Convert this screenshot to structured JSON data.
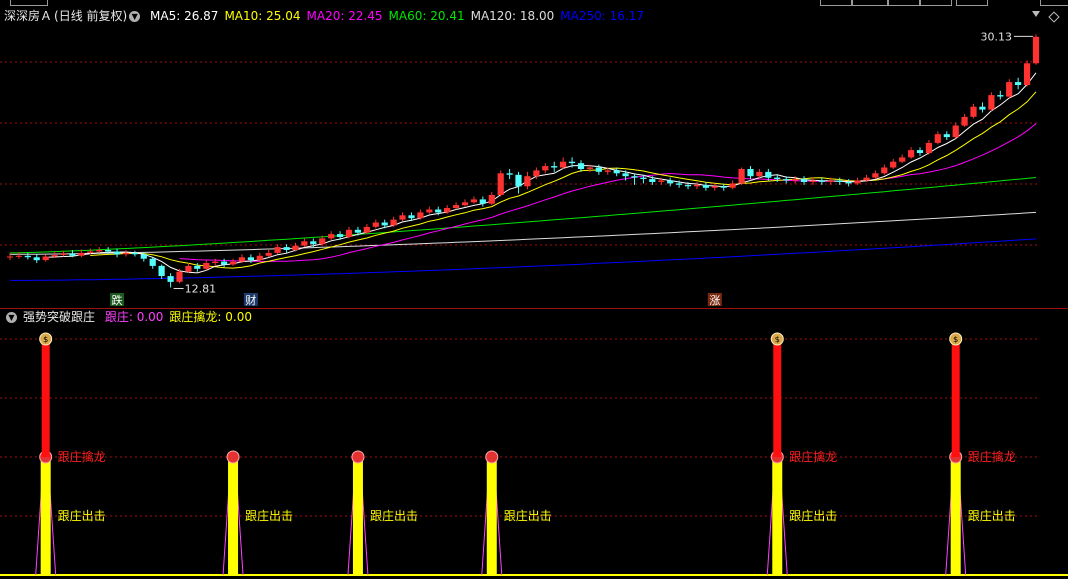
{
  "colors": {
    "up": "#ff3232",
    "down": "#54fcfc",
    "ma5": "#ffffff",
    "ma10": "#ffff00",
    "ma20": "#ff00ff",
    "ma60": "#00e600",
    "ma120": "#dddddd",
    "ma250": "#0000ff",
    "grid": "#a01010",
    "zhuang": "#ff40ff",
    "qinlong": "#ffff00"
  },
  "price_panel": {
    "stock_name": "深深房Ａ",
    "period": "(日线 前复权)",
    "ma": [
      {
        "label": "MA5:",
        "value": "26.87",
        "color": "#ffffff"
      },
      {
        "label": "MA10:",
        "value": "25.04",
        "color": "#ffff00"
      },
      {
        "label": "MA20:",
        "value": "22.45",
        "color": "#ff00ff"
      },
      {
        "label": "MA60:",
        "value": "20.41",
        "color": "#00e600"
      },
      {
        "label": "MA120:",
        "value": "18.00",
        "color": "#dddddd"
      },
      {
        "label": "MA250:",
        "value": "16.17",
        "color": "#0000ff"
      }
    ],
    "high_label": "30.13",
    "low_label": "12.81",
    "markers": [
      {
        "text": "跌",
        "bg": "#1d5a1d",
        "fg": "#ffffff"
      },
      {
        "text": "财",
        "bg": "#1b3a6a",
        "fg": "#ffffff"
      },
      {
        "text": "涨",
        "bg": "#7a2a10",
        "fg": "#ffffff"
      }
    ]
  },
  "indicator_panel": {
    "name": "强势突破跟庄",
    "items": [
      {
        "label": "跟庄:",
        "value": "0.00",
        "color": "#ff40ff"
      },
      {
        "label": "跟庄擒龙:",
        "value": "0.00",
        "color": "#ffff00"
      }
    ],
    "label_qinlong": "跟庄擒龙",
    "label_chuji": "跟庄出击"
  },
  "chart_data": {
    "type": "candlestick",
    "title": "深深房Ａ (日线 前复权)",
    "y_labels_shown": [
      "30.13",
      "12.81"
    ],
    "candles": [
      [
        14.9,
        14.95,
        15.2,
        14.7
      ],
      [
        14.95,
        15.0,
        15.25,
        14.8
      ],
      [
        15.0,
        14.9,
        15.2,
        14.75
      ],
      [
        14.9,
        14.7,
        15.1,
        14.5
      ],
      [
        14.7,
        14.95,
        15.1,
        14.6
      ],
      [
        14.95,
        15.05,
        15.3,
        14.85
      ],
      [
        15.05,
        15.15,
        15.35,
        14.95
      ],
      [
        15.15,
        15.0,
        15.4,
        14.9
      ],
      [
        15.0,
        15.2,
        15.45,
        14.9
      ],
      [
        15.2,
        15.3,
        15.5,
        15.1
      ],
      [
        15.3,
        15.4,
        15.6,
        15.2
      ],
      [
        15.4,
        15.3,
        15.6,
        15.1
      ],
      [
        15.3,
        15.1,
        15.5,
        14.9
      ],
      [
        15.1,
        15.2,
        15.4,
        14.95
      ],
      [
        15.2,
        15.1,
        15.35,
        14.95
      ],
      [
        15.1,
        14.8,
        15.25,
        14.6
      ],
      [
        14.8,
        14.3,
        14.9,
        14.1
      ],
      [
        14.3,
        13.6,
        14.4,
        13.4
      ],
      [
        13.6,
        13.2,
        13.8,
        12.81
      ],
      [
        13.2,
        13.9,
        14.1,
        13.1
      ],
      [
        13.9,
        14.3,
        14.5,
        13.8
      ],
      [
        14.3,
        14.1,
        14.5,
        13.9
      ],
      [
        14.1,
        14.5,
        14.7,
        14.0
      ],
      [
        14.5,
        14.6,
        14.8,
        14.3
      ],
      [
        14.6,
        14.4,
        14.8,
        14.2
      ],
      [
        14.4,
        14.6,
        14.8,
        14.3
      ],
      [
        14.6,
        14.9,
        15.1,
        14.5
      ],
      [
        14.9,
        14.7,
        15.1,
        14.5
      ],
      [
        14.7,
        15.0,
        15.2,
        14.6
      ],
      [
        15.0,
        15.2,
        15.4,
        14.9
      ],
      [
        15.2,
        15.6,
        15.8,
        15.1
      ],
      [
        15.6,
        15.4,
        15.8,
        15.2
      ],
      [
        15.4,
        15.7,
        15.9,
        15.3
      ],
      [
        15.7,
        16.0,
        16.2,
        15.6
      ],
      [
        16.0,
        15.8,
        16.2,
        15.6
      ],
      [
        15.8,
        16.2,
        16.4,
        15.7
      ],
      [
        16.2,
        16.5,
        16.7,
        16.1
      ],
      [
        16.5,
        16.3,
        16.7,
        16.1
      ],
      [
        16.3,
        16.8,
        17.0,
        16.2
      ],
      [
        16.8,
        16.6,
        17.0,
        16.4
      ],
      [
        16.6,
        17.0,
        17.2,
        16.5
      ],
      [
        17.0,
        17.3,
        17.5,
        16.9
      ],
      [
        17.3,
        17.1,
        17.5,
        16.9
      ],
      [
        17.1,
        17.5,
        17.7,
        17.0
      ],
      [
        17.5,
        17.8,
        18.0,
        17.4
      ],
      [
        17.8,
        17.6,
        18.0,
        17.4
      ],
      [
        17.6,
        18.0,
        18.2,
        17.5
      ],
      [
        18.0,
        18.2,
        18.4,
        17.9
      ],
      [
        18.2,
        18.0,
        18.4,
        17.8
      ],
      [
        18.0,
        18.3,
        18.5,
        17.9
      ],
      [
        18.3,
        18.5,
        18.7,
        18.2
      ],
      [
        18.5,
        18.7,
        18.9,
        18.4
      ],
      [
        18.7,
        18.9,
        19.1,
        18.6
      ],
      [
        18.9,
        18.6,
        19.1,
        18.4
      ],
      [
        18.6,
        19.2,
        19.4,
        18.5
      ],
      [
        19.2,
        20.7,
        20.9,
        19.1
      ],
      [
        20.7,
        20.6,
        21.0,
        20.3
      ],
      [
        20.6,
        19.8,
        20.8,
        19.3
      ],
      [
        19.8,
        20.5,
        20.8,
        19.6
      ],
      [
        20.5,
        20.9,
        21.1,
        20.3
      ],
      [
        20.9,
        21.2,
        21.4,
        20.7
      ],
      [
        21.2,
        21.1,
        21.5,
        20.8
      ],
      [
        21.1,
        21.5,
        21.8,
        21.0
      ],
      [
        21.5,
        21.4,
        21.8,
        21.1
      ],
      [
        21.4,
        21.0,
        21.6,
        20.8
      ],
      [
        21.0,
        21.1,
        21.3,
        20.8
      ],
      [
        21.1,
        20.8,
        21.3,
        20.6
      ],
      [
        20.8,
        20.9,
        21.1,
        20.6
      ],
      [
        20.9,
        20.7,
        21.1,
        20.5
      ],
      [
        20.7,
        20.5,
        20.9,
        20.2
      ],
      [
        20.5,
        20.4,
        20.7,
        19.9
      ],
      [
        20.4,
        20.3,
        20.6,
        20.0
      ],
      [
        20.3,
        20.1,
        20.5,
        19.9
      ],
      [
        20.1,
        20.2,
        20.4,
        19.9
      ],
      [
        20.2,
        20.0,
        20.4,
        19.8
      ],
      [
        20.0,
        19.9,
        20.2,
        19.7
      ],
      [
        19.9,
        19.8,
        20.1,
        19.6
      ],
      [
        19.8,
        19.9,
        20.1,
        19.6
      ],
      [
        19.9,
        19.7,
        20.1,
        19.5
      ],
      [
        19.7,
        19.8,
        20.0,
        19.5
      ],
      [
        19.8,
        19.7,
        20.0,
        19.5
      ],
      [
        19.7,
        20.0,
        20.2,
        19.6
      ],
      [
        20.0,
        21.0,
        21.1,
        19.9
      ],
      [
        21.0,
        20.5,
        21.2,
        20.3
      ],
      [
        20.5,
        20.8,
        21.0,
        20.3
      ],
      [
        20.8,
        20.4,
        21.0,
        20.2
      ],
      [
        20.4,
        20.3,
        20.6,
        20.1
      ],
      [
        20.3,
        20.2,
        20.5,
        20.0
      ],
      [
        20.2,
        20.3,
        20.5,
        20.0
      ],
      [
        20.3,
        20.1,
        20.5,
        19.9
      ],
      [
        20.1,
        20.2,
        20.4,
        19.9
      ],
      [
        20.2,
        20.1,
        20.4,
        19.9
      ],
      [
        20.1,
        20.2,
        20.4,
        19.9
      ],
      [
        20.2,
        20.1,
        20.4,
        19.9
      ],
      [
        20.1,
        20.0,
        20.3,
        19.8
      ],
      [
        20.0,
        20.2,
        20.4,
        19.9
      ],
      [
        20.2,
        20.4,
        20.6,
        20.1
      ],
      [
        20.4,
        20.7,
        20.9,
        20.3
      ],
      [
        20.7,
        21.1,
        21.3,
        20.6
      ],
      [
        21.1,
        21.5,
        21.7,
        21.0
      ],
      [
        21.5,
        21.8,
        22.0,
        21.4
      ],
      [
        21.8,
        22.3,
        22.5,
        21.7
      ],
      [
        22.3,
        22.1,
        22.5,
        21.9
      ],
      [
        22.1,
        22.8,
        23.0,
        22.0
      ],
      [
        22.8,
        23.4,
        23.6,
        22.7
      ],
      [
        23.4,
        23.2,
        23.6,
        23.0
      ],
      [
        23.2,
        24.0,
        24.2,
        23.1
      ],
      [
        24.0,
        24.6,
        24.8,
        23.9
      ],
      [
        24.6,
        25.3,
        25.5,
        24.5
      ],
      [
        25.3,
        25.1,
        25.6,
        24.9
      ],
      [
        25.1,
        26.1,
        26.3,
        25.0
      ],
      [
        26.1,
        26.0,
        26.4,
        25.8
      ],
      [
        26.0,
        27.0,
        27.2,
        25.9
      ],
      [
        27.0,
        26.8,
        27.3,
        26.5
      ],
      [
        26.8,
        28.3,
        28.5,
        26.7
      ],
      [
        28.3,
        30.13,
        30.3,
        28.2
      ]
    ],
    "ma_series": [
      {
        "name": "MA5",
        "start": 14.9,
        "end": 26.87
      },
      {
        "name": "MA10",
        "start": 14.95,
        "end": 25.04
      },
      {
        "name": "MA20",
        "start": 15.0,
        "end": 22.45
      },
      {
        "name": "MA60",
        "start": 15.2,
        "end": 20.41
      },
      {
        "name": "MA120",
        "start": 15.1,
        "end": 18.0
      },
      {
        "name": "MA250",
        "start": 13.3,
        "end": 16.17
      }
    ],
    "signals": [
      {
        "candle": 4,
        "type": "跟庄擒龙"
      },
      {
        "candle": 25,
        "type": "跟庄出击"
      },
      {
        "candle": 39,
        "type": "跟庄出击"
      },
      {
        "candle": 54,
        "type": "跟庄出击"
      },
      {
        "candle": 86,
        "type": "跟庄擒龙"
      },
      {
        "candle": 106,
        "type": "跟庄擒龙"
      }
    ]
  }
}
